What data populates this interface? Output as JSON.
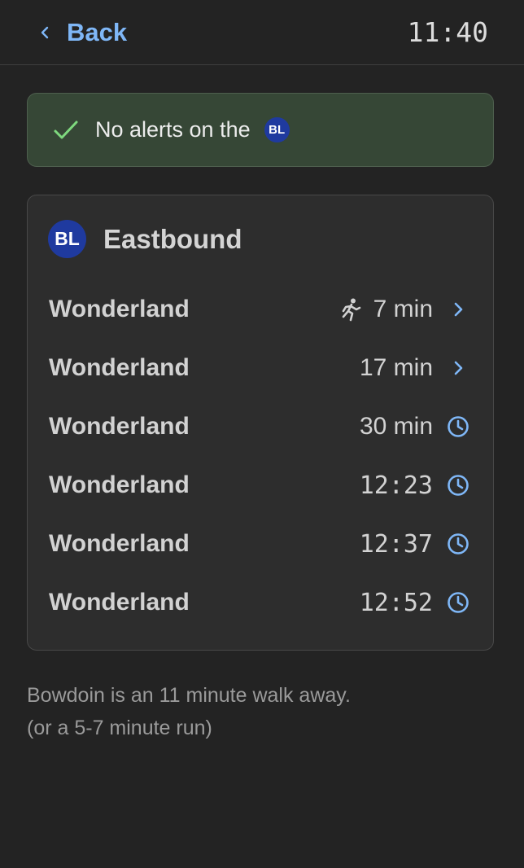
{
  "header": {
    "back_label": "Back",
    "clock": "11:40"
  },
  "alert": {
    "text": "No alerts on the",
    "line_badge": "BL"
  },
  "card": {
    "line_badge": "BL",
    "direction": "Eastbound",
    "rows": [
      {
        "destination": "Wonderland",
        "time": "7 min",
        "run_icon": true,
        "end_icon": "chevron-right-icon"
      },
      {
        "destination": "Wonderland",
        "time": "17 min",
        "run_icon": false,
        "end_icon": "chevron-right-icon"
      },
      {
        "destination": "Wonderland",
        "time": "30 min",
        "run_icon": false,
        "end_icon": "clock-icon"
      },
      {
        "destination": "Wonderland",
        "time": "12:23",
        "run_icon": false,
        "end_icon": "clock-icon"
      },
      {
        "destination": "Wonderland",
        "time": "12:37",
        "run_icon": false,
        "end_icon": "clock-icon"
      },
      {
        "destination": "Wonderland",
        "time": "12:52",
        "run_icon": false,
        "end_icon": "clock-icon"
      }
    ]
  },
  "walk_note": {
    "line1": "Bowdoin is an 11 minute walk away.",
    "line2": "(or a 5-7 minute run)"
  },
  "colors": {
    "accent": "#7fb7f7",
    "blue_line": "#1f3a9f",
    "alert_bg": "#364736",
    "check": "#7ed97e"
  }
}
